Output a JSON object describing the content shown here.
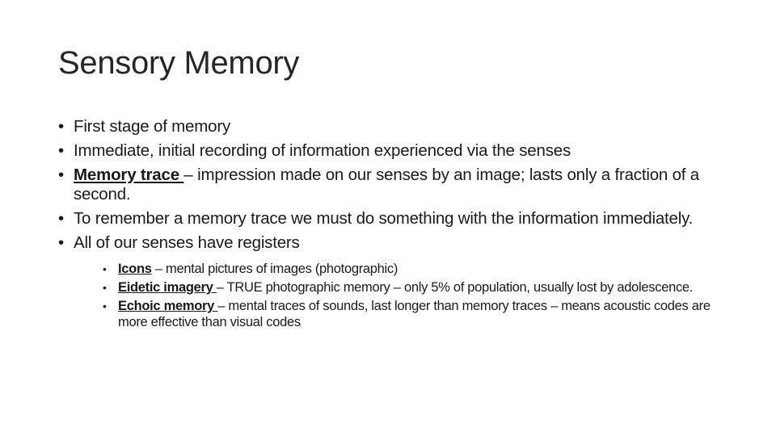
{
  "slide": {
    "title": "Sensory Memory",
    "bullets": [
      {
        "text": "First stage of memory"
      },
      {
        "text": "Immediate, initial recording of information experienced via the senses"
      },
      {
        "term": "Memory trace ",
        "text": " – impression made on our senses by an image; lasts only a fraction of a second."
      },
      {
        "text": "To remember a memory trace we must do something with the information immediately."
      },
      {
        "text": "All of our senses have registers"
      }
    ],
    "sub_bullets": [
      {
        "term": "Icons",
        "text": " – mental pictures of images (photographic)"
      },
      {
        "term": "Eidetic imagery ",
        "text": " – TRUE photographic memory – only 5% of population, usually lost by adolescence."
      },
      {
        "term": "Echoic memory ",
        "text": " – mental traces of sounds, last longer than memory traces – means acoustic codes are more effective than visual codes"
      }
    ]
  }
}
